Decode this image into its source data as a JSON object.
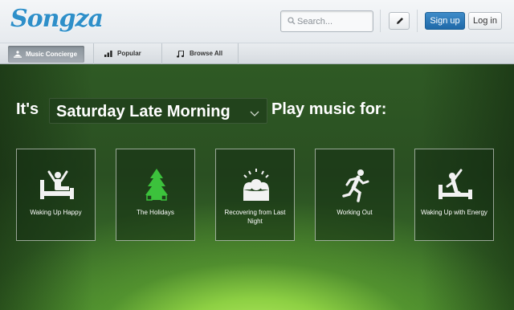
{
  "brand": {
    "logo": "Songza"
  },
  "header": {
    "search_placeholder": "Search...",
    "signup_label": "Sign up",
    "login_label": "Log in"
  },
  "nav": {
    "tabs": [
      {
        "label": "Music Concierge",
        "icon": "concierge-icon",
        "active": true
      },
      {
        "label": "Popular",
        "icon": "bar-chart-icon",
        "active": false
      },
      {
        "label": "Browse All",
        "icon": "music-note-icon",
        "active": false
      }
    ]
  },
  "headline": {
    "prefix": "It's",
    "time_value": "Saturday Late Morning",
    "suffix": "Play music for:"
  },
  "activities": [
    {
      "label": "Waking Up Happy",
      "icon": "waking-up-happy-icon"
    },
    {
      "label": "The Holidays",
      "icon": "christmas-tree-icon",
      "color": "#3cc23c"
    },
    {
      "label": "Recovering from Last Night",
      "icon": "headache-icon"
    },
    {
      "label": "Working Out",
      "icon": "running-person-icon"
    },
    {
      "label": "Waking Up with Energy",
      "icon": "waking-up-energy-icon"
    }
  ],
  "colors": {
    "brand_blue": "#2e8fc9",
    "signup_blue": "#1f69a8",
    "accent_green": "#8dd043"
  }
}
